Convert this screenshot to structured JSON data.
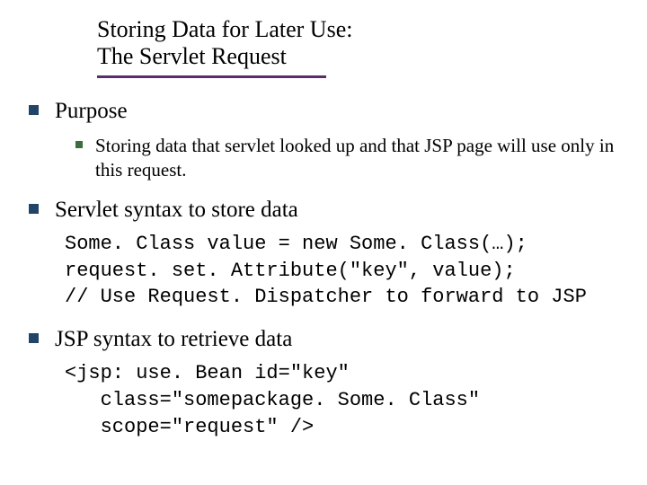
{
  "title": {
    "line1": "Storing Data for Later Use:",
    "line2": "The Servlet Request"
  },
  "sections": {
    "purpose": {
      "heading": "Purpose",
      "sub": "Storing data that servlet looked up and that JSP page will use only in this request."
    },
    "servlet": {
      "heading": "Servlet syntax to store data",
      "code1": "Some. Class value = new Some. Class(…);",
      "code2": "request. set. Attribute(\"key\", value);",
      "code3": "// Use Request. Dispatcher to forward to JSP"
    },
    "jsp": {
      "heading": "JSP syntax to retrieve data",
      "code1": "<jsp: use. Bean id=\"key\"",
      "code2": "   class=\"somepackage. Some. Class\"",
      "code3": "   scope=\"request\" />"
    }
  }
}
